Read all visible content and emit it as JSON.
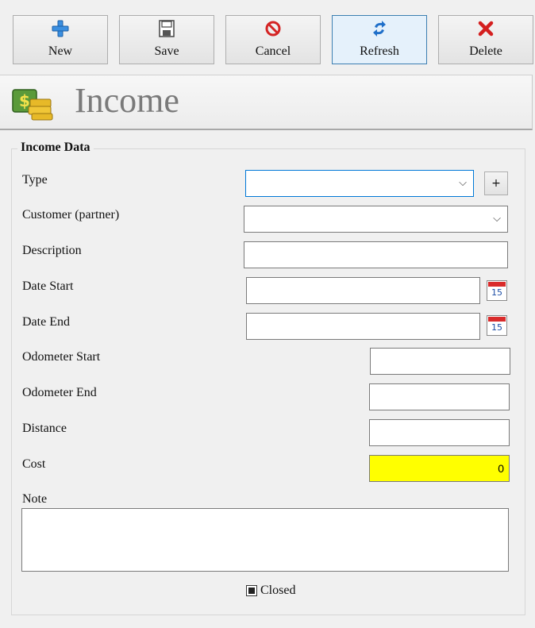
{
  "toolbar": {
    "buttons": [
      {
        "label": "New",
        "icon": "plus-icon"
      },
      {
        "label": "Save",
        "icon": "floppy-disk-icon"
      },
      {
        "label": "Cancel",
        "icon": "cancel-icon"
      },
      {
        "label": "Refresh",
        "icon": "refresh-icon"
      },
      {
        "label": "Delete",
        "icon": "delete-x-icon"
      }
    ]
  },
  "header": {
    "title": "Income",
    "icon": "money-icon"
  },
  "form": {
    "group_title": "Income Data",
    "type": {
      "label": "Type",
      "value": ""
    },
    "add_type_button": "+",
    "customer": {
      "label": "Customer (partner)",
      "value": ""
    },
    "description": {
      "label": "Description",
      "value": ""
    },
    "date_start": {
      "label": "Date Start",
      "value": ""
    },
    "date_end": {
      "label": "Date End",
      "value": ""
    },
    "calendar_day": "15",
    "odometer_start": {
      "label": "Odometer Start",
      "value": ""
    },
    "odometer_end": {
      "label": "Odometer End",
      "value": ""
    },
    "distance": {
      "label": "Distance",
      "value": ""
    },
    "cost": {
      "label": "Cost",
      "value": "0"
    },
    "note": {
      "label": "Note",
      "value": ""
    },
    "closed": {
      "label": "Closed",
      "checked": true
    }
  },
  "colors": {
    "cost_highlight": "#ffff00",
    "focus_border": "#0078d7",
    "title_gray": "#7a7a7a"
  }
}
